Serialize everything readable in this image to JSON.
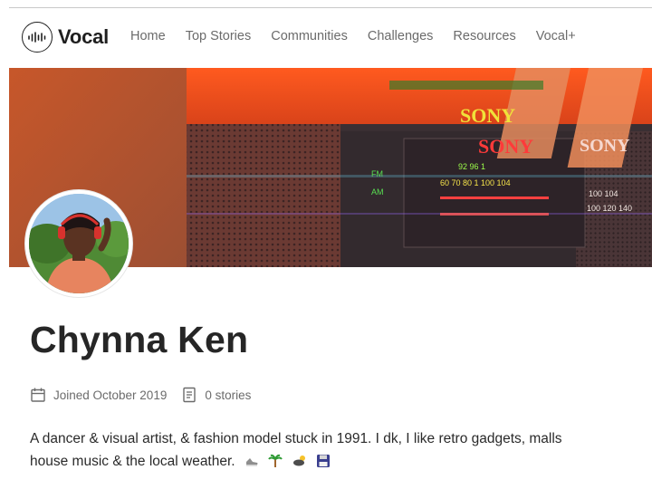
{
  "nav": {
    "logo_text": "Vocal",
    "links": [
      "Home",
      "Top Stories",
      "Communities",
      "Challenges",
      "Resources",
      "Vocal+"
    ]
  },
  "banner": {
    "brand_text": "SONY",
    "dial_row_1": "92  96  1",
    "dial_row_2": "60  70  80  1  100  104",
    "dial_row_3": "100  104",
    "dial_row_4": "100  120  140",
    "band_fm": "FM",
    "band_am": "AM"
  },
  "profile": {
    "name": "Chynna Ken",
    "joined": "Joined October 2019",
    "stories": "0 stories",
    "bio_line_1": "A dancer & visual artist, & fashion model stuck in 1991. I dk, I like retro gadgets, malls",
    "bio_line_2": "house music & the local weather."
  },
  "icons": {
    "calendar": "calendar-icon",
    "document": "document-icon",
    "bio_emojis": [
      "sneaker-icon",
      "palm-tree-icon",
      "sun-behind-cloud-icon",
      "floppy-disk-icon"
    ]
  },
  "colors": {
    "banner_orange": "#e8501c",
    "banner_brown": "#b25a32",
    "text": "#262626",
    "muted": "#6b6b6b"
  }
}
